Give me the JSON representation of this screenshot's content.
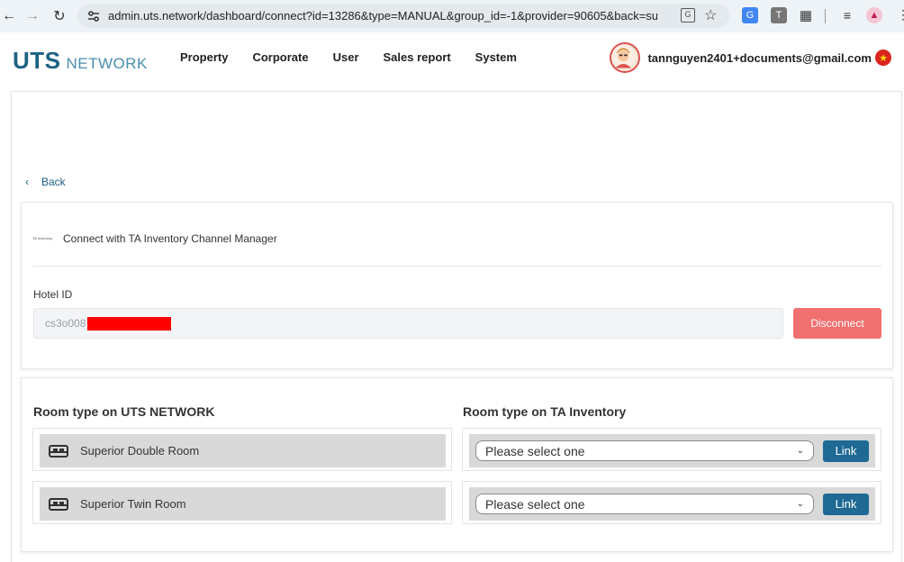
{
  "browser": {
    "url": "admin.uts.network/dashboard/connect?id=13286&type=MANUAL&group_id=-1&provider=90605&back=supplier"
  },
  "header": {
    "logo_main": "UTS",
    "logo_sub": "NETWORK",
    "menu": [
      "Property",
      "Corporate",
      "User",
      "Sales report",
      "System"
    ],
    "user_email": "tannguyen2401+documents@gmail.com"
  },
  "back_label": "Back",
  "connection": {
    "provider_logo_text": "TA Inventory",
    "title": "Connect with TA Inventory Channel Manager",
    "hotel_id_label": "Hotel ID",
    "hotel_id_value": "cs3o008",
    "disconnect_label": "Disconnect"
  },
  "mapping": {
    "left_title": "Room type on UTS NETWORK",
    "right_title": "Room type on TA Inventory",
    "rows": [
      {
        "room_name": "Superior Double Room",
        "select_value": "Please select one",
        "link_label": "Link"
      },
      {
        "room_name": "Superior Twin Room",
        "select_value": "Please select one",
        "link_label": "Link"
      }
    ]
  },
  "colors": {
    "brand": "#1e6283",
    "disconnect": "#f07070",
    "link_button": "#1e6a94"
  }
}
